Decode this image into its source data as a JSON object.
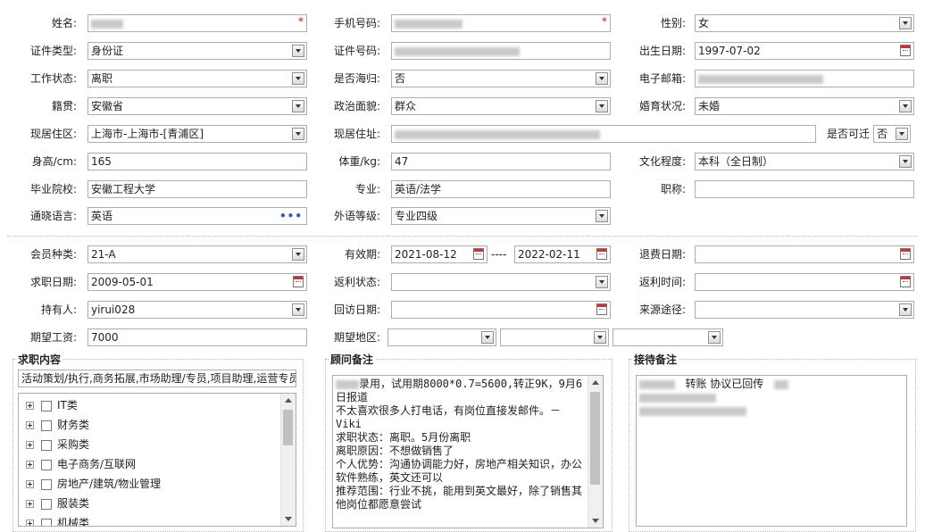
{
  "row1": {
    "name_label": "姓名:",
    "phone_label": "手机号码:",
    "gender_label": "性别:",
    "gender_value": "女"
  },
  "row2": {
    "idtype_label": "证件类型:",
    "idtype_value": "身份证",
    "idno_label": "证件号码:",
    "birth_label": "出生日期:",
    "birth_value": "1997-07-02"
  },
  "row3": {
    "work_label": "工作状态:",
    "work_value": "离职",
    "returnee_label": "是否海归:",
    "returnee_value": "否",
    "email_label": "电子邮箱:"
  },
  "row4": {
    "native_label": "籍贯:",
    "native_value": "安徽省",
    "political_label": "政治面貌:",
    "political_value": "群众",
    "marital_label": "婚育状况:",
    "marital_value": "未婚"
  },
  "row5": {
    "residence_label": "现居住区:",
    "residence_value": "上海市-上海市-[青浦区]",
    "address_label": "现居住址:",
    "relocate_label": "是否可迁",
    "relocate_value": "否"
  },
  "row6": {
    "height_label": "身高/cm:",
    "height_value": "165",
    "weight_label": "体重/kg:",
    "weight_value": "47",
    "education_label": "文化程度:",
    "education_value": "本科（全日制）"
  },
  "row7": {
    "school_label": "毕业院校:",
    "school_value": "安徽工程大学",
    "major_label": "专业:",
    "major_value": "英语/法学",
    "title_label": "职称:",
    "title_value": ""
  },
  "row8": {
    "language_label": "通晓语言:",
    "language_value": "英语",
    "foreign_label": "外语等级:",
    "foreign_value": "专业四级"
  },
  "row9": {
    "member_label": "会员种类:",
    "member_value": "21-A",
    "valid_label": "有效期:",
    "valid_from": "2021-08-12",
    "valid_sep": "----",
    "valid_to": "2022-02-11",
    "refund_label": "退费日期:"
  },
  "row10": {
    "jobdate_label": "求职日期:",
    "jobdate_value": "2009-05-01",
    "rebate_state_label": "返利状态:",
    "rebate_time_label": "返利时间:"
  },
  "row11": {
    "holder_label": "持有人:",
    "holder_value": "yirui028",
    "revisit_label": "回访日期:",
    "source_label": "来源途径:"
  },
  "row12": {
    "salary_label": "期望工资:",
    "salary_value": "7000",
    "region_label": "期望地区:"
  },
  "job": {
    "title": "求职内容",
    "summary": "活动策划/执行,商务拓展,市场助理/专员,项目助理,运营专员",
    "categories": [
      "IT类",
      "财务类",
      "采购类",
      "电子商务/互联网",
      "房地产/建筑/物业管理",
      "服装类",
      "机械类"
    ]
  },
  "advisor": {
    "title": "顾问备注",
    "lines": [
      "录用，试用期8000*0.7=5600,转正9K，9月6日报道",
      "",
      "不太喜欢很多人打电话，有岗位直接发邮件。－Viki",
      "",
      "求职状态：离职。5月份离职",
      "离职原因：不想做销售了",
      "个人优势：沟通协调能力好，房地产相关知识，办公软件熟练，英文还可以",
      "推荐范围：行业不挑，能用到英文最好，除了销售其他岗位都愿意尝试"
    ]
  },
  "reception": {
    "title": "接待备注",
    "line1": "转账  协议已回传"
  }
}
